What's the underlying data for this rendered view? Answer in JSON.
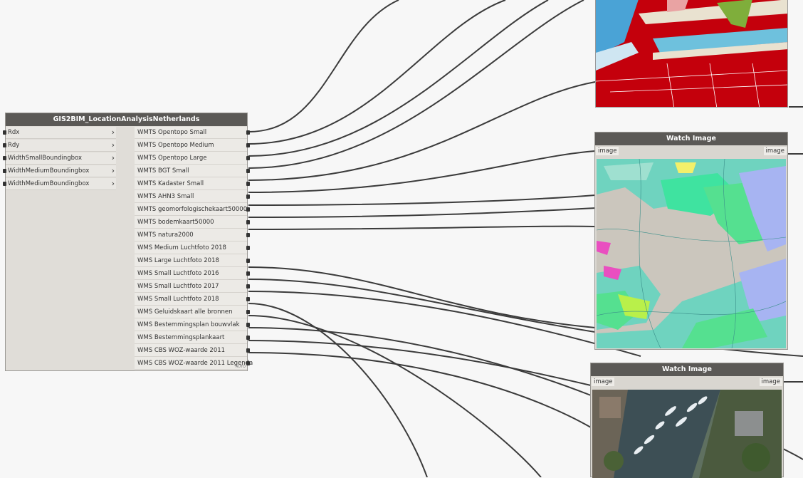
{
  "main_node": {
    "title": "GIS2BIM_LocationAnalysisNetherlands",
    "inputs": [
      "Rdx",
      "Rdy",
      "WidthSmallBoundingbox",
      "WidthMediumBoundingbox",
      "WidthMediumBoundingbox"
    ],
    "outputs": [
      "WMTS Opentopo Small",
      "WMTS Opentopo Medium",
      "WMTS Opentopo Large",
      "WMTS BGT Small",
      "WMTS Kadaster Small",
      "WMTS AHN3 Small",
      "WMTS geomorfologischekaart50000",
      "WMTS bodemkaart50000",
      "WMTS natura2000",
      "WMS Medium Luchtfoto 2018",
      "WMS Large Luchtfoto 2018",
      "WMS Small Luchtfoto 2016",
      "WMS Small Luchtfoto 2017",
      "WMS Small Luchtfoto 2018",
      "WMS Geluidskaart alle bronnen",
      "WMS Bestemmingsplan bouwvlak",
      "WMS Bestemmingsplankaart",
      "WMS CBS WOZ-waarde 2011",
      "WMS CBS WOZ-waarde 2011 Legenda"
    ],
    "auto_label": "AUTO"
  },
  "watch1": {
    "title": "Watch Image",
    "input_label": "image",
    "output_label": "image"
  },
  "watch2": {
    "title": "Watch Image",
    "input_label": "image",
    "output_label": "image"
  },
  "colors": {
    "wire": "#3b3b3b",
    "node_header": "#5b5956",
    "node_body": "#e0ddd8",
    "canvas": "#f7f7f7"
  }
}
